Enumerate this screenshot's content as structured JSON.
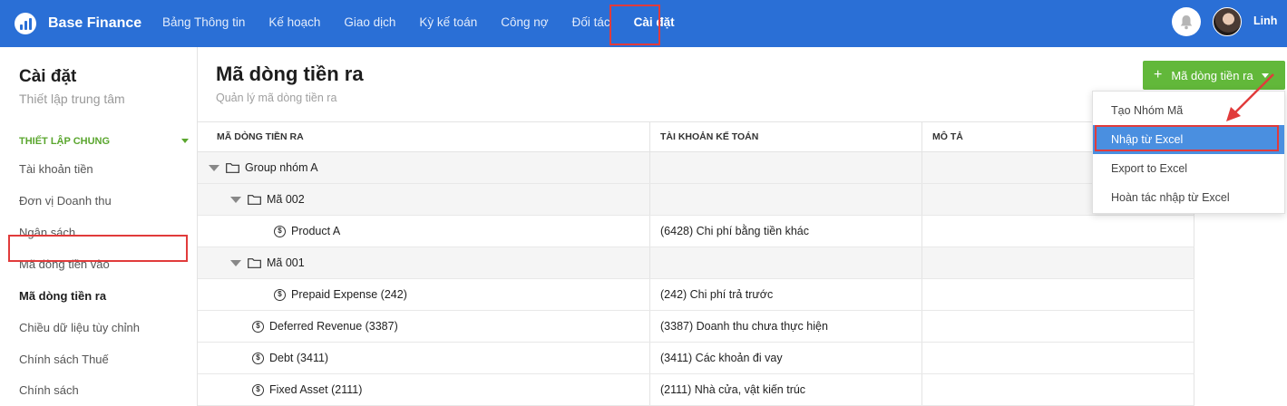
{
  "app": {
    "name": "Base Finance"
  },
  "nav": {
    "items": [
      "Bảng Thông tin",
      "Kế hoạch",
      "Giao dịch",
      "Kỳ kế toán",
      "Công nợ",
      "Đối tác",
      "Cài đặt"
    ],
    "active": "Cài đặt"
  },
  "user": {
    "name": "Linh"
  },
  "sidebar": {
    "title": "Cài đặt",
    "subtitle": "Thiết lập trung tâm",
    "section": "THIẾT LẬP CHUNG",
    "items": [
      "Tài khoản tiền",
      "Đơn vị Doanh thu",
      "Ngân sách",
      "Mã dòng tiền vào",
      "Mã dòng tiền ra",
      "Chiều dữ liệu tùy chỉnh",
      "Chính sách Thuế",
      "Chính sách"
    ],
    "active": "Mã dòng tiền ra"
  },
  "main": {
    "title": "Mã dòng tiền ra",
    "subtitle": "Quản lý mã dòng tiền ra",
    "add_button": "Mã dòng tiền ra"
  },
  "table": {
    "columns": [
      "MÃ DÒNG TIỀN RA",
      "TÀI KHOẢN KẾ TOÁN",
      "MÔ TẢ"
    ],
    "rows": [
      {
        "type": "group",
        "name": "Group nhóm A",
        "account": "",
        "description": ""
      },
      {
        "type": "group",
        "name": "Mã 002",
        "account": "",
        "description": ""
      },
      {
        "type": "item",
        "name": "Product A",
        "account": "(6428) Chi phí bằng tiền khác",
        "description": ""
      },
      {
        "type": "group",
        "name": "Mã 001",
        "account": "",
        "description": ""
      },
      {
        "type": "item",
        "name": "Prepaid Expense (242)",
        "account": "(242) Chi phí trả trước",
        "description": ""
      },
      {
        "type": "item",
        "name": "Deferred Revenue (3387)",
        "account": "(3387) Doanh thu chưa thực hiện",
        "description": ""
      },
      {
        "type": "item",
        "name": "Debt (3411)",
        "account": "(3411) Các khoản đi vay",
        "description": ""
      },
      {
        "type": "item",
        "name": "Fixed Asset (2111)",
        "account": "(2111) Nhà cửa, vật kiến trúc",
        "description": ""
      }
    ]
  },
  "dropdown": {
    "items": [
      "Tạo Nhóm Mã",
      "Nhập từ Excel",
      "Export to Excel",
      "Hoàn tác nhập từ Excel"
    ],
    "selected": "Nhập từ Excel"
  },
  "colors": {
    "topbar": "#2a6fd6",
    "accent_green": "#62b83a",
    "highlight_red": "#e13b3b",
    "selected_blue": "#4a8fe0"
  },
  "icons": [
    "logo-icon",
    "bell-icon",
    "caret-down-icon",
    "folder-icon",
    "dollar-coin-icon",
    "expand-triangle-icon",
    "plus-icon",
    "annotation-arrow"
  ]
}
